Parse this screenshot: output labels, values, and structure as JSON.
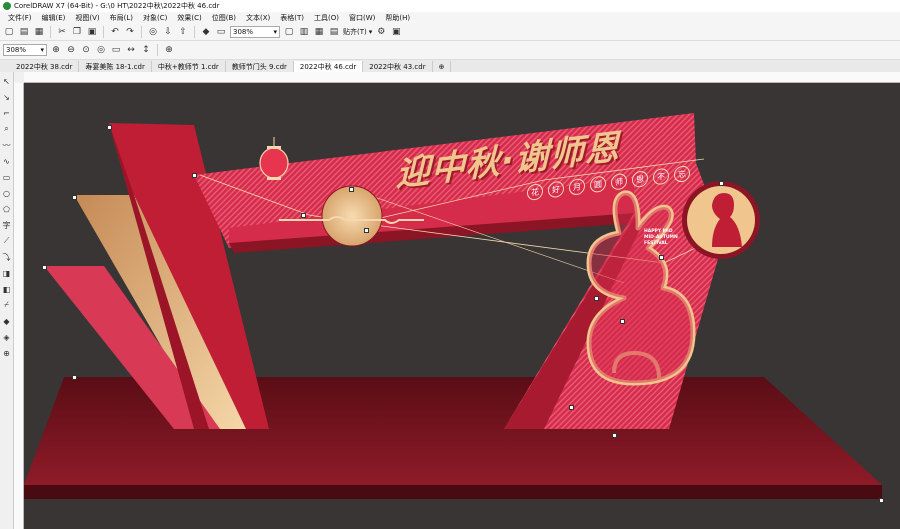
{
  "window": {
    "title": "CorelDRAW X7 (64-Bit) - G:\\0 HT\\2022中秋\\2022中秋 46.cdr"
  },
  "menu": [
    "文件(F)",
    "编辑(E)",
    "视图(V)",
    "布局(L)",
    "对象(C)",
    "效果(C)",
    "位图(B)",
    "文本(X)",
    "表格(T)",
    "工具(O)",
    "窗口(W)",
    "帮助(H)"
  ],
  "toolbar1": {
    "zoom": "308%",
    "snap": "贴齐(T)"
  },
  "toolbar2": {
    "zoom": "308%"
  },
  "tabs": [
    "2022中秋 38.cdr",
    "寿宴美陈 18-1.cdr",
    "中秋+教师节 1.cdr",
    "教师节门头 9.cdr",
    "2022中秋 46.cdr",
    "2022中秋 43.cdr"
  ],
  "active_tab": 4,
  "design": {
    "headline": "迎中秋·谢师恩",
    "sub_chars": [
      "花",
      "好",
      "月",
      "圆",
      "师",
      "恩",
      "不",
      "忘"
    ],
    "english": [
      "HAPPY MID",
      "MID-AUTUMN",
      "FESTIVAL"
    ]
  },
  "colors": {
    "bg_canvas": "#393535",
    "red": "#d62c4b",
    "dark_red": "#8b1525",
    "gold": "#f0c58e"
  }
}
